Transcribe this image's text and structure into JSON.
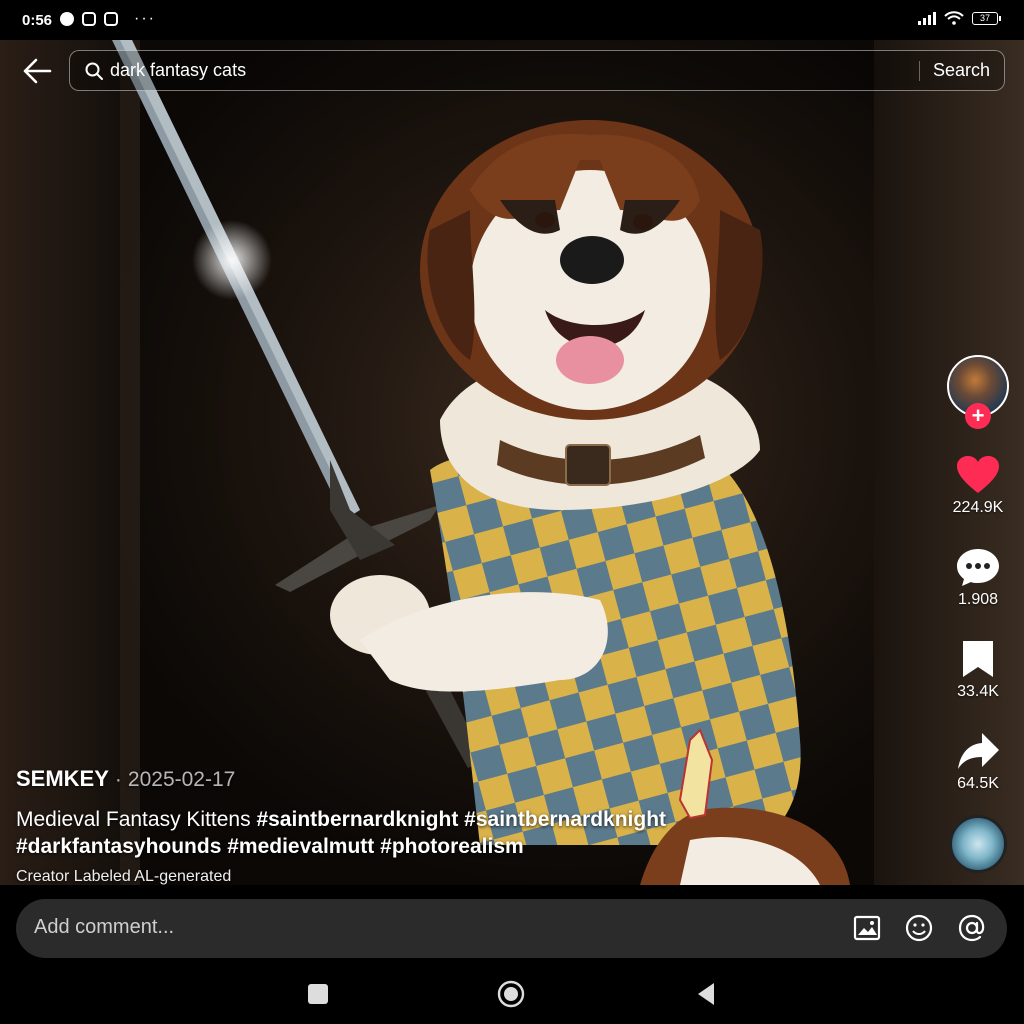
{
  "status_bar": {
    "time": "0:56",
    "battery": "37"
  },
  "search": {
    "query": "dark fantasy cats",
    "button_label": "Search"
  },
  "rail": {
    "likes": "224.9K",
    "comments": "1.908",
    "saves": "33.4K",
    "shares": "64.5K"
  },
  "caption": {
    "author": "SEMKEY",
    "separator": "·",
    "date": "2025-02-17",
    "text": "Medieval Fantasy Kittens",
    "hashtags": [
      "#saintbernardknight",
      "#saintbernardknight",
      "#darkfantasyhounds",
      "#medievalmutt",
      "#photorealism"
    ],
    "ai_label": "Creator Labeled AL-generated"
  },
  "comment_bar": {
    "placeholder": "Add comment..."
  },
  "colors": {
    "like": "#fe2c55",
    "follow": "#fe2c55"
  }
}
